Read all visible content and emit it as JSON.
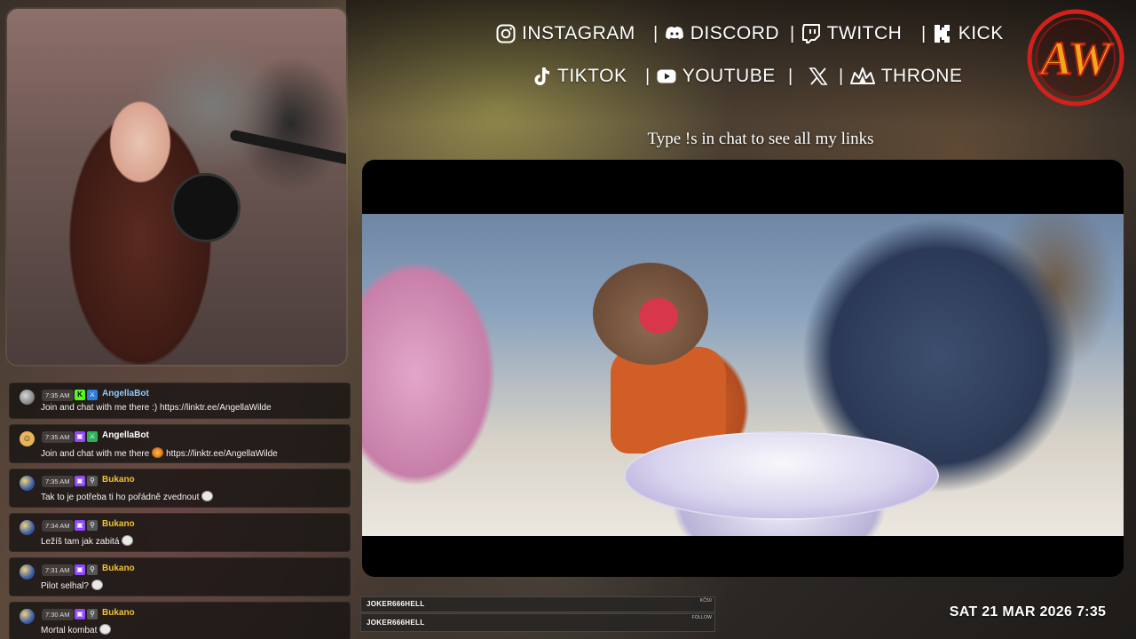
{
  "socials": {
    "row1": [
      {
        "icon": "instagram-icon",
        "label": "INSTAGRAM"
      },
      {
        "icon": "discord-icon",
        "label": "DISCORD"
      },
      {
        "icon": "twitch-icon",
        "label": "TWITCH"
      },
      {
        "icon": "kick-icon",
        "label": "KICK"
      }
    ],
    "row2": [
      {
        "icon": "tiktok-icon",
        "label": "TIKTOK"
      },
      {
        "icon": "youtube-icon",
        "label": "YOUTUBE"
      },
      {
        "icon": "x-icon",
        "label": ""
      },
      {
        "icon": "throne-icon",
        "label": "THRONE"
      }
    ],
    "separator": "|"
  },
  "logo": {
    "text": "AW",
    "colors": {
      "ring": "#d3201a",
      "letters": "#f0a81a"
    }
  },
  "tagline": "Type !s in chat to see all my links",
  "chat": {
    "messages": [
      {
        "time": "7:35 AM",
        "user": "AngellaBot",
        "user_color": "#8ecbff",
        "badges": [
          "kick",
          "blue"
        ],
        "text": "Join and chat with me there :) https://linktr.ee/AngellaWilde",
        "emote": ""
      },
      {
        "time": "7:35 AM",
        "user": "AngellaBot",
        "user_color": "#ffffff",
        "badges": [
          "twitch",
          "green"
        ],
        "text_before": "Join and chat with me there",
        "emote": "flower",
        "text_after": "https://linktr.ee/AngellaWilde"
      },
      {
        "time": "7:35 AM",
        "user": "Bukano",
        "user_color": "#f1c232",
        "badges": [
          "twitch",
          "gray"
        ],
        "text": "Tak to je potřeba ti ho pořádně zvednout",
        "emote": "face"
      },
      {
        "time": "7:34 AM",
        "user": "Bukano",
        "user_color": "#f1c232",
        "badges": [
          "twitch",
          "gray"
        ],
        "text": "Ležíš tam jak zabitá",
        "emote": "face"
      },
      {
        "time": "7:31 AM",
        "user": "Bukano",
        "user_color": "#f1c232",
        "badges": [
          "twitch",
          "gray"
        ],
        "text": "Pilot selhal?",
        "emote": "face"
      },
      {
        "time": "7:30 AM",
        "user": "Bukano",
        "user_color": "#f1c232",
        "badges": [
          "twitch",
          "gray"
        ],
        "text": "Mortal kombat",
        "emote": "face"
      }
    ]
  },
  "alerts": [
    {
      "name": "JOKER666HELL",
      "kind": "KČ50"
    },
    {
      "name": "JOKER666HELL",
      "kind": "FOLLOW"
    }
  ],
  "datetime": "SAT 21 MAR 2026 7:35"
}
